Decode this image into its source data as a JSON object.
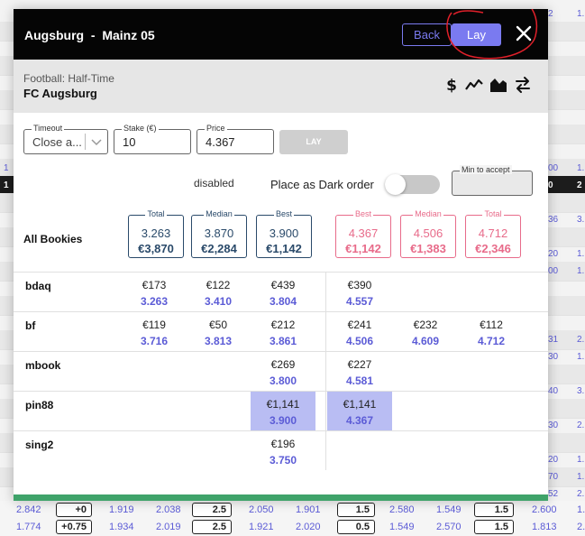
{
  "match": {
    "home": "Augsburg",
    "separator": "-",
    "away": "Mainz 05"
  },
  "buttons": {
    "back": "Back",
    "lay": "Lay",
    "lay_submit": "LAY"
  },
  "market": {
    "sport_market": "Football: Half-Time",
    "selection": "FC Augsburg"
  },
  "toolbar_icons": [
    "dollar-icon",
    "line-chart-icon",
    "area-chart-icon",
    "swap-icon"
  ],
  "form": {
    "timeout": {
      "label": "Timeout",
      "value": "Close a..."
    },
    "stake": {
      "label": "Stake (€)",
      "value": "10"
    },
    "price": {
      "label": "Price",
      "value": "4.367"
    },
    "disabled_text": "disabled",
    "dark_order_label": "Place as Dark order",
    "dark_order_enabled": false,
    "min_accept": {
      "label": "Min to accept",
      "value": ""
    }
  },
  "summary": {
    "label": "All Bookies",
    "back": [
      {
        "label": "Total",
        "odds": "3.263",
        "stake": "€3,870"
      },
      {
        "label": "Median",
        "odds": "3.870",
        "stake": "€2,284"
      },
      {
        "label": "Best",
        "odds": "3.900",
        "stake": "€1,142"
      }
    ],
    "lay": [
      {
        "label": "Best",
        "odds": "4.367",
        "stake": "€1,142"
      },
      {
        "label": "Median",
        "odds": "4.506",
        "stake": "€1,383"
      },
      {
        "label": "Total",
        "odds": "4.712",
        "stake": "€2,346"
      }
    ]
  },
  "bookies": [
    {
      "name": "bdaq",
      "cells": [
        {
          "stake": "€173",
          "odds": "3.263"
        },
        {
          "stake": "€122",
          "odds": "3.410"
        },
        {
          "stake": "€439",
          "odds": "3.804"
        },
        {
          "stake": "€390",
          "odds": "4.557"
        },
        null,
        null
      ]
    },
    {
      "name": "bf",
      "cells": [
        {
          "stake": "€119",
          "odds": "3.716"
        },
        {
          "stake": "€50",
          "odds": "3.813"
        },
        {
          "stake": "€212",
          "odds": "3.861"
        },
        {
          "stake": "€241",
          "odds": "4.506"
        },
        {
          "stake": "€232",
          "odds": "4.609"
        },
        {
          "stake": "€112",
          "odds": "4.712"
        }
      ]
    },
    {
      "name": "mbook",
      "cells": [
        null,
        null,
        {
          "stake": "€269",
          "odds": "3.800"
        },
        {
          "stake": "€227",
          "odds": "4.581"
        },
        null,
        null
      ]
    },
    {
      "name": "pin88",
      "cells": [
        null,
        null,
        {
          "stake": "€1,141",
          "odds": "3.900",
          "highlight": true
        },
        {
          "stake": "€1,141",
          "odds": "4.367",
          "highlight": true
        },
        null,
        null
      ]
    },
    {
      "name": "sing2",
      "cells": [
        null,
        null,
        {
          "stake": "€196",
          "odds": "3.750"
        },
        null,
        null,
        null
      ]
    }
  ],
  "background": {
    "right_edge": [
      {
        "a": "2",
        "b": "1."
      },
      {
        "a": "",
        "b": ""
      },
      {
        "a": "",
        "b": ""
      },
      {
        "a": "",
        "b": ""
      },
      {
        "a": "",
        "b": ""
      },
      {
        "a": "",
        "b": ""
      },
      {
        "a": "",
        "b": ""
      },
      {
        "a": "",
        "b": ""
      },
      {
        "a": "",
        "b": ""
      },
      {
        "a": "00",
        "b": "1."
      },
      {
        "a": "0",
        "b": "2",
        "dark": true
      },
      {
        "a": "",
        "b": ""
      },
      {
        "a": "36",
        "b": "3."
      },
      {
        "a": "",
        "b": ""
      },
      {
        "a": "20",
        "b": "1."
      },
      {
        "a": "00",
        "b": "1."
      },
      {
        "a": "",
        "b": ""
      },
      {
        "a": "",
        "b": ""
      },
      {
        "a": "",
        "b": ""
      },
      {
        "a": "31",
        "b": "2."
      },
      {
        "a": "30",
        "b": "1."
      },
      {
        "a": "",
        "b": ""
      },
      {
        "a": "40",
        "b": "3."
      },
      {
        "a": "",
        "b": ""
      },
      {
        "a": "30",
        "b": "2."
      },
      {
        "a": "",
        "b": ""
      },
      {
        "a": "20",
        "b": "1."
      },
      {
        "a": "70",
        "b": "1."
      },
      {
        "a": "52",
        "b": "2."
      }
    ],
    "left_edge": [
      {
        "row": 9,
        "text": "1"
      },
      {
        "row": 10,
        "text": "1",
        "dark": true
      }
    ],
    "bottom_rows": [
      [
        "2.842",
        "+0",
        "1.919",
        "2.038",
        "2.5",
        "2.050",
        "1.901",
        "1.5",
        "2.580",
        "1.549",
        "1.5",
        "2.600",
        "1."
      ],
      [
        "1.774",
        "+0.75",
        "1.934",
        "2.019",
        "2.5",
        "1.921",
        "2.020",
        "0.5",
        "1.549",
        "2.570",
        "1.5",
        "1.813",
        "2."
      ]
    ]
  }
}
